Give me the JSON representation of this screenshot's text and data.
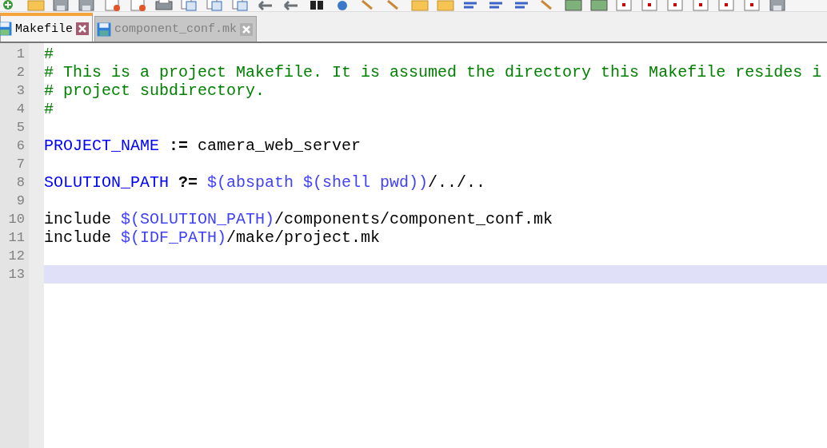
{
  "tabs": [
    {
      "label": "Makefile",
      "selected": true
    },
    {
      "label": "component_conf.mk",
      "selected": false
    }
  ],
  "editor": {
    "lines": [
      {
        "number": "1",
        "current": false,
        "tokens": [
          {
            "kind": "comment",
            "text": "#"
          }
        ]
      },
      {
        "number": "2",
        "current": false,
        "tokens": [
          {
            "kind": "comment",
            "text": "# This is a project Makefile. It is assumed the directory this Makefile resides i"
          }
        ]
      },
      {
        "number": "3",
        "current": false,
        "tokens": [
          {
            "kind": "comment",
            "text": "# project subdirectory."
          }
        ]
      },
      {
        "number": "4",
        "current": false,
        "tokens": [
          {
            "kind": "comment",
            "text": "#"
          }
        ]
      },
      {
        "number": "5",
        "current": false
      },
      {
        "number": "6",
        "current": false,
        "tokens": [
          {
            "kind": "variable",
            "text": "PROJECT_NAME"
          },
          {
            "kind": "operator",
            "text": " :="
          },
          {
            "kind": "text",
            "text": " camera_web_server"
          }
        ]
      },
      {
        "number": "7",
        "current": false
      },
      {
        "number": "8",
        "current": false,
        "tokens": [
          {
            "kind": "variable",
            "text": "SOLUTION_PATH"
          },
          {
            "kind": "operator",
            "text": " ?="
          },
          {
            "kind": "reference",
            "text": " $(abspath $(shell pwd))"
          },
          {
            "kind": "text",
            "text": "/../.."
          }
        ]
      },
      {
        "number": "9",
        "current": false
      },
      {
        "number": "10",
        "current": false,
        "tokens": [
          {
            "kind": "text",
            "text": "include "
          },
          {
            "kind": "reference",
            "text": "$(SOLUTION_PATH)"
          },
          {
            "kind": "text",
            "text": "/components/component_conf.mk"
          }
        ]
      },
      {
        "number": "11",
        "current": false,
        "tokens": [
          {
            "kind": "text",
            "text": "include "
          },
          {
            "kind": "reference",
            "text": "$(IDF_PATH)"
          },
          {
            "kind": "text",
            "text": "/make/project.mk"
          }
        ]
      },
      {
        "number": "12",
        "current": false
      },
      {
        "number": "13",
        "current": true
      }
    ]
  }
}
